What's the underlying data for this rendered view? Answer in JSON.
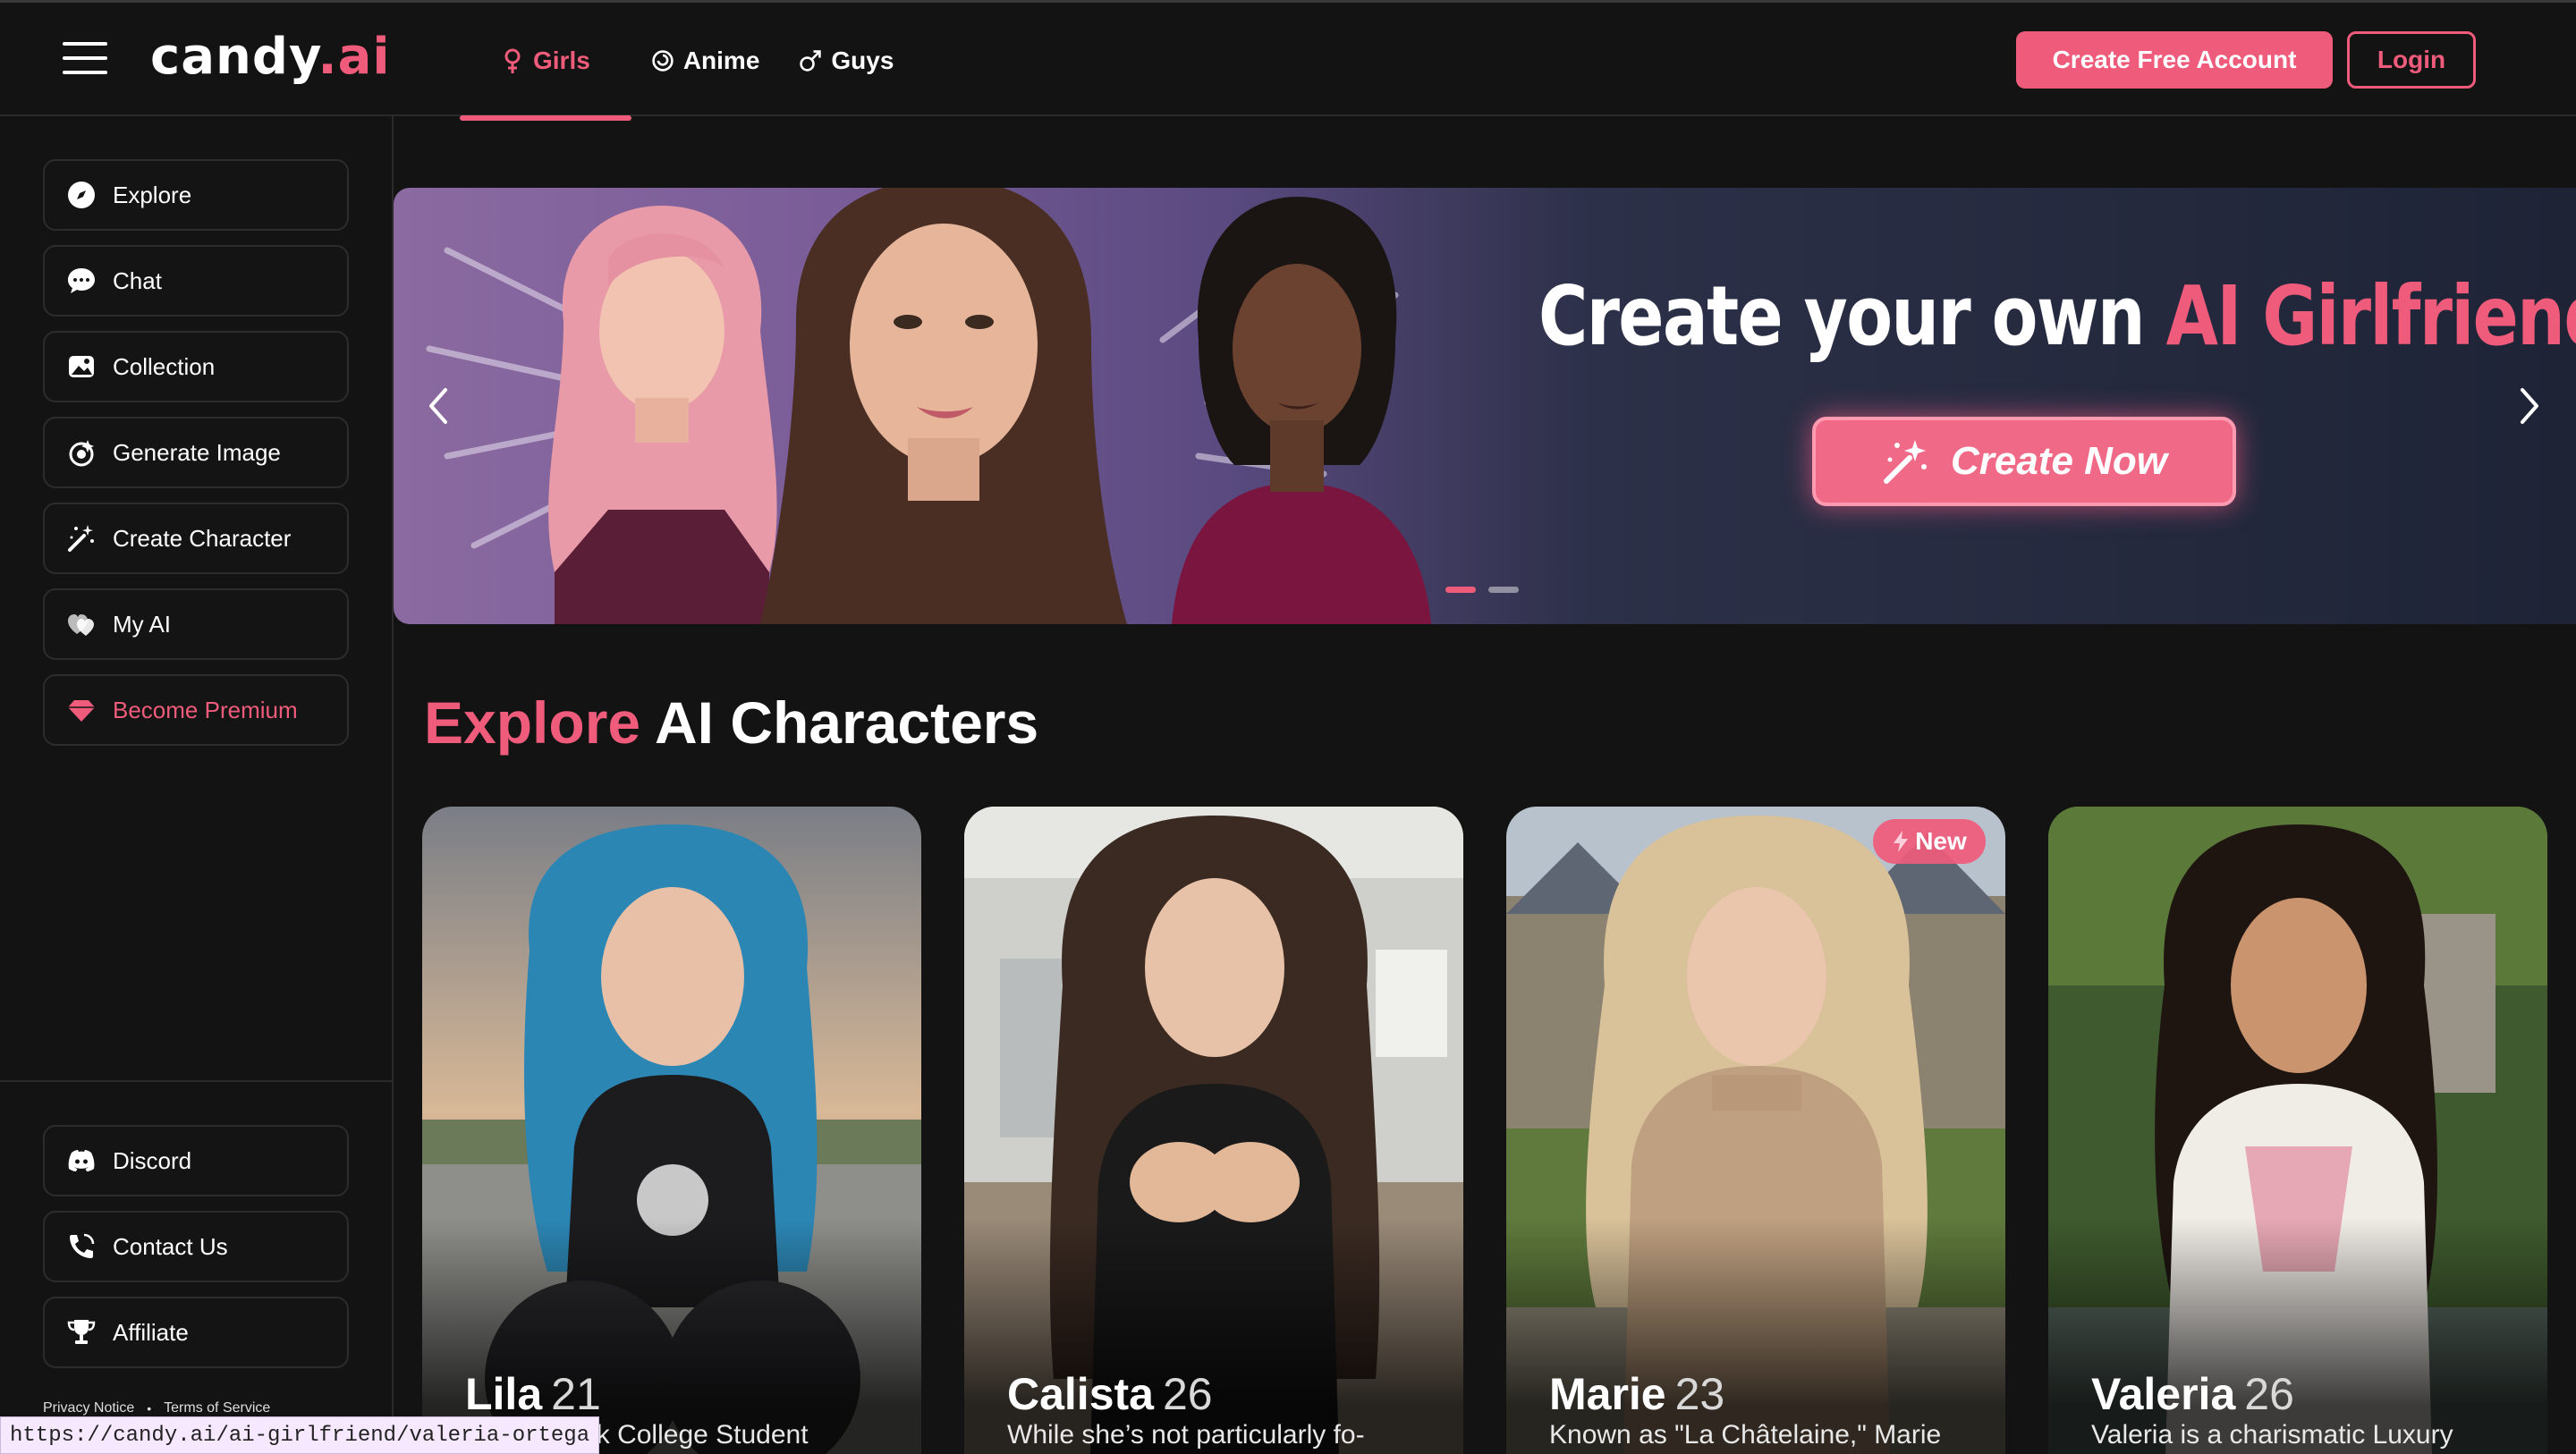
{
  "brand": {
    "logo_main": "candy",
    "logo_dot": ".ai",
    "accent_color": "#ef5b7a"
  },
  "topnav": {
    "tabs": [
      {
        "label": "Girls",
        "icon": "female-icon",
        "active": true
      },
      {
        "label": "Anime",
        "icon": "anime-swirl-icon",
        "active": false
      },
      {
        "label": "Guys",
        "icon": "male-icon",
        "active": false
      }
    ],
    "create_account": "Create Free Account",
    "login": "Login"
  },
  "sidebar": {
    "items": [
      {
        "label": "Explore",
        "icon": "compass-icon"
      },
      {
        "label": "Chat",
        "icon": "chat-bubble-icon"
      },
      {
        "label": "Collection",
        "icon": "image-gallery-icon"
      },
      {
        "label": "Generate Image",
        "icon": "image-generate-icon"
      },
      {
        "label": "Create Character",
        "icon": "magic-wand-icon"
      },
      {
        "label": "My AI",
        "icon": "hearts-icon"
      },
      {
        "label": "Become Premium",
        "icon": "diamond-icon"
      }
    ],
    "bottom_items": [
      {
        "label": "Discord",
        "icon": "discord-icon"
      },
      {
        "label": "Contact Us",
        "icon": "phone-icon"
      },
      {
        "label": "Affiliate",
        "icon": "trophy-icon"
      }
    ],
    "legal": {
      "privacy": "Privacy Notice",
      "bullet": "•",
      "terms": "Terms of Service"
    }
  },
  "hero": {
    "title_white": "Create your own",
    "title_accent": "AI Girlfriend",
    "cta": "Create Now",
    "slide_count": 2,
    "active_slide": 1
  },
  "explore": {
    "title_accent": "Explore",
    "title_rest": "AI Characters"
  },
  "characters": [
    {
      "name": "Lila",
      "age": "21",
      "desc": "Gothic-punk College Student",
      "badge": ""
    },
    {
      "name": "Calista",
      "age": "26",
      "desc": "While she’s not particularly fo-",
      "badge": ""
    },
    {
      "name": "Marie",
      "age": "23",
      "desc": "Known as \"La Châtelaine,\" Marie",
      "badge": "New"
    },
    {
      "name": "Valeria",
      "age": "26",
      "desc": "Valeria is a charismatic Luxury",
      "badge": ""
    }
  ],
  "status_url": "https://candy.ai/ai-girlfriend/valeria-ortega"
}
